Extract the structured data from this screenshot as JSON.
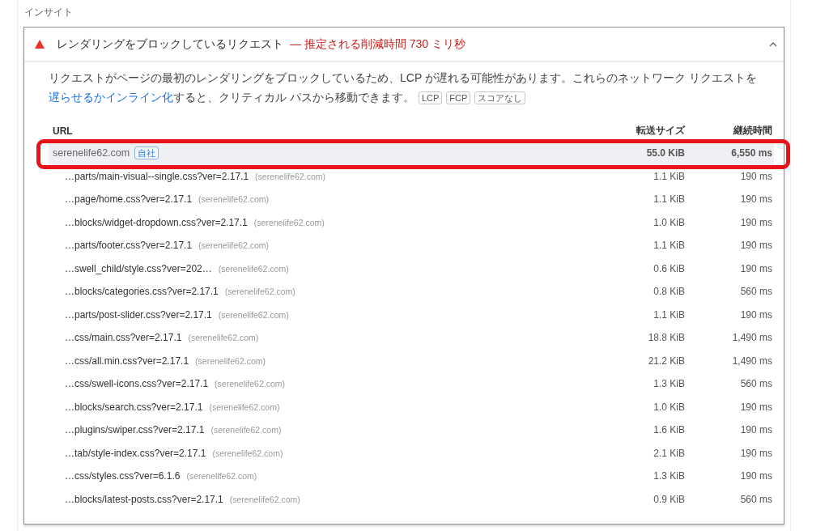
{
  "section_label": "インサイト",
  "audit": {
    "expanded": true,
    "title": "レンダリングをブロックしているリクエスト",
    "savings": "— 推定される削減時間 730 ミリ秒",
    "description": {
      "before": "リクエストがページの最初のレンダリングをブロックしているため、LCP が遅れる可能性があります。これらのネットワーク リクエストを",
      "link": "遅らせるかインライン化",
      "after": "すると、クリティカル パスから移動できます。"
    },
    "tags": [
      "LCP",
      "FCP",
      "スコアなし"
    ],
    "columns": [
      "URL",
      "転送サイズ",
      "継続時間"
    ],
    "groups": [
      {
        "host": "serenelife62.com",
        "badge": "自社",
        "size": "55.0 KiB",
        "duration": "6,550 ms",
        "highlighted": true,
        "children": [
          {
            "url": "…parts/main-visual--single.css?ver=2.17.1",
            "host": "(serenelife62.com)",
            "size": "1.1 KiB",
            "duration": "190 ms"
          },
          {
            "url": "…page/home.css?ver=2.17.1",
            "host": "(serenelife62.com)",
            "size": "1.1 KiB",
            "duration": "190 ms"
          },
          {
            "url": "…blocks/widget-dropdown.css?ver=2.17.1",
            "host": "(serenelife62.com)",
            "size": "1.0 KiB",
            "duration": "190 ms"
          },
          {
            "url": "…parts/footer.css?ver=2.17.1",
            "host": "(serenelife62.com)",
            "size": "1.1 KiB",
            "duration": "190 ms"
          },
          {
            "url": "…swell_child/style.css?ver=202…",
            "host": "(serenelife62.com)",
            "size": "0.6 KiB",
            "duration": "190 ms"
          },
          {
            "url": "…blocks/categories.css?ver=2.17.1",
            "host": "(serenelife62.com)",
            "size": "0.8 KiB",
            "duration": "560 ms"
          },
          {
            "url": "…parts/post-slider.css?ver=2.17.1",
            "host": "(serenelife62.com)",
            "size": "1.1 KiB",
            "duration": "190 ms"
          },
          {
            "url": "…css/main.css?ver=2.17.1",
            "host": "(serenelife62.com)",
            "size": "18.8 KiB",
            "duration": "1,490 ms"
          },
          {
            "url": "…css/all.min.css?ver=2.17.1",
            "host": "(serenelife62.com)",
            "size": "21.2 KiB",
            "duration": "1,490 ms"
          },
          {
            "url": "…css/swell-icons.css?ver=2.17.1",
            "host": "(serenelife62.com)",
            "size": "1.3 KiB",
            "duration": "560 ms"
          },
          {
            "url": "…blocks/search.css?ver=2.17.1",
            "host": "(serenelife62.com)",
            "size": "1.0 KiB",
            "duration": "190 ms"
          },
          {
            "url": "…plugins/swiper.css?ver=2.17.1",
            "host": "(serenelife62.com)",
            "size": "1.6 KiB",
            "duration": "190 ms"
          },
          {
            "url": "…tab/style-index.css?ver=2.17.1",
            "host": "(serenelife62.com)",
            "size": "2.1 KiB",
            "duration": "190 ms"
          },
          {
            "url": "…css/styles.css?ver=6.1.6",
            "host": "(serenelife62.com)",
            "size": "1.3 KiB",
            "duration": "190 ms"
          },
          {
            "url": "…blocks/latest-posts.css?ver=2.17.1",
            "host": "(serenelife62.com)",
            "size": "0.9 KiB",
            "duration": "560 ms"
          }
        ]
      }
    ]
  }
}
